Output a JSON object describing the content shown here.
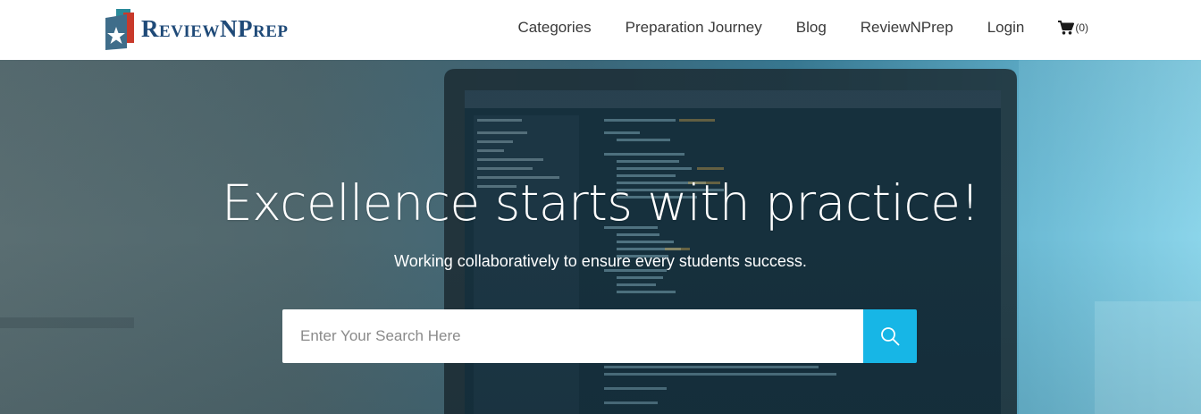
{
  "brand": {
    "logo_parts": {
      "r": "R",
      "eview": "EVIEW",
      "n": "N",
      "p": "P",
      "rep": "REP"
    },
    "colors": {
      "navy": "#1f4a78",
      "teal": "#2a8a9a",
      "red": "#c8392b",
      "slate": "#3f6d8a"
    }
  },
  "nav": {
    "items": [
      "Categories",
      "Preparation Journey",
      "Blog",
      "ReviewNPrep",
      "Login"
    ],
    "cart_count": "(0)",
    "cart_icon": "shopping-cart-icon"
  },
  "hero": {
    "headline": "Excellence starts with practice!",
    "subheadline": "Working collaboratively to ensure every students success.",
    "search": {
      "placeholder": "Enter Your Search Here",
      "value": "",
      "button_icon": "magnifier-icon",
      "button_color": "#17b6e6"
    }
  }
}
